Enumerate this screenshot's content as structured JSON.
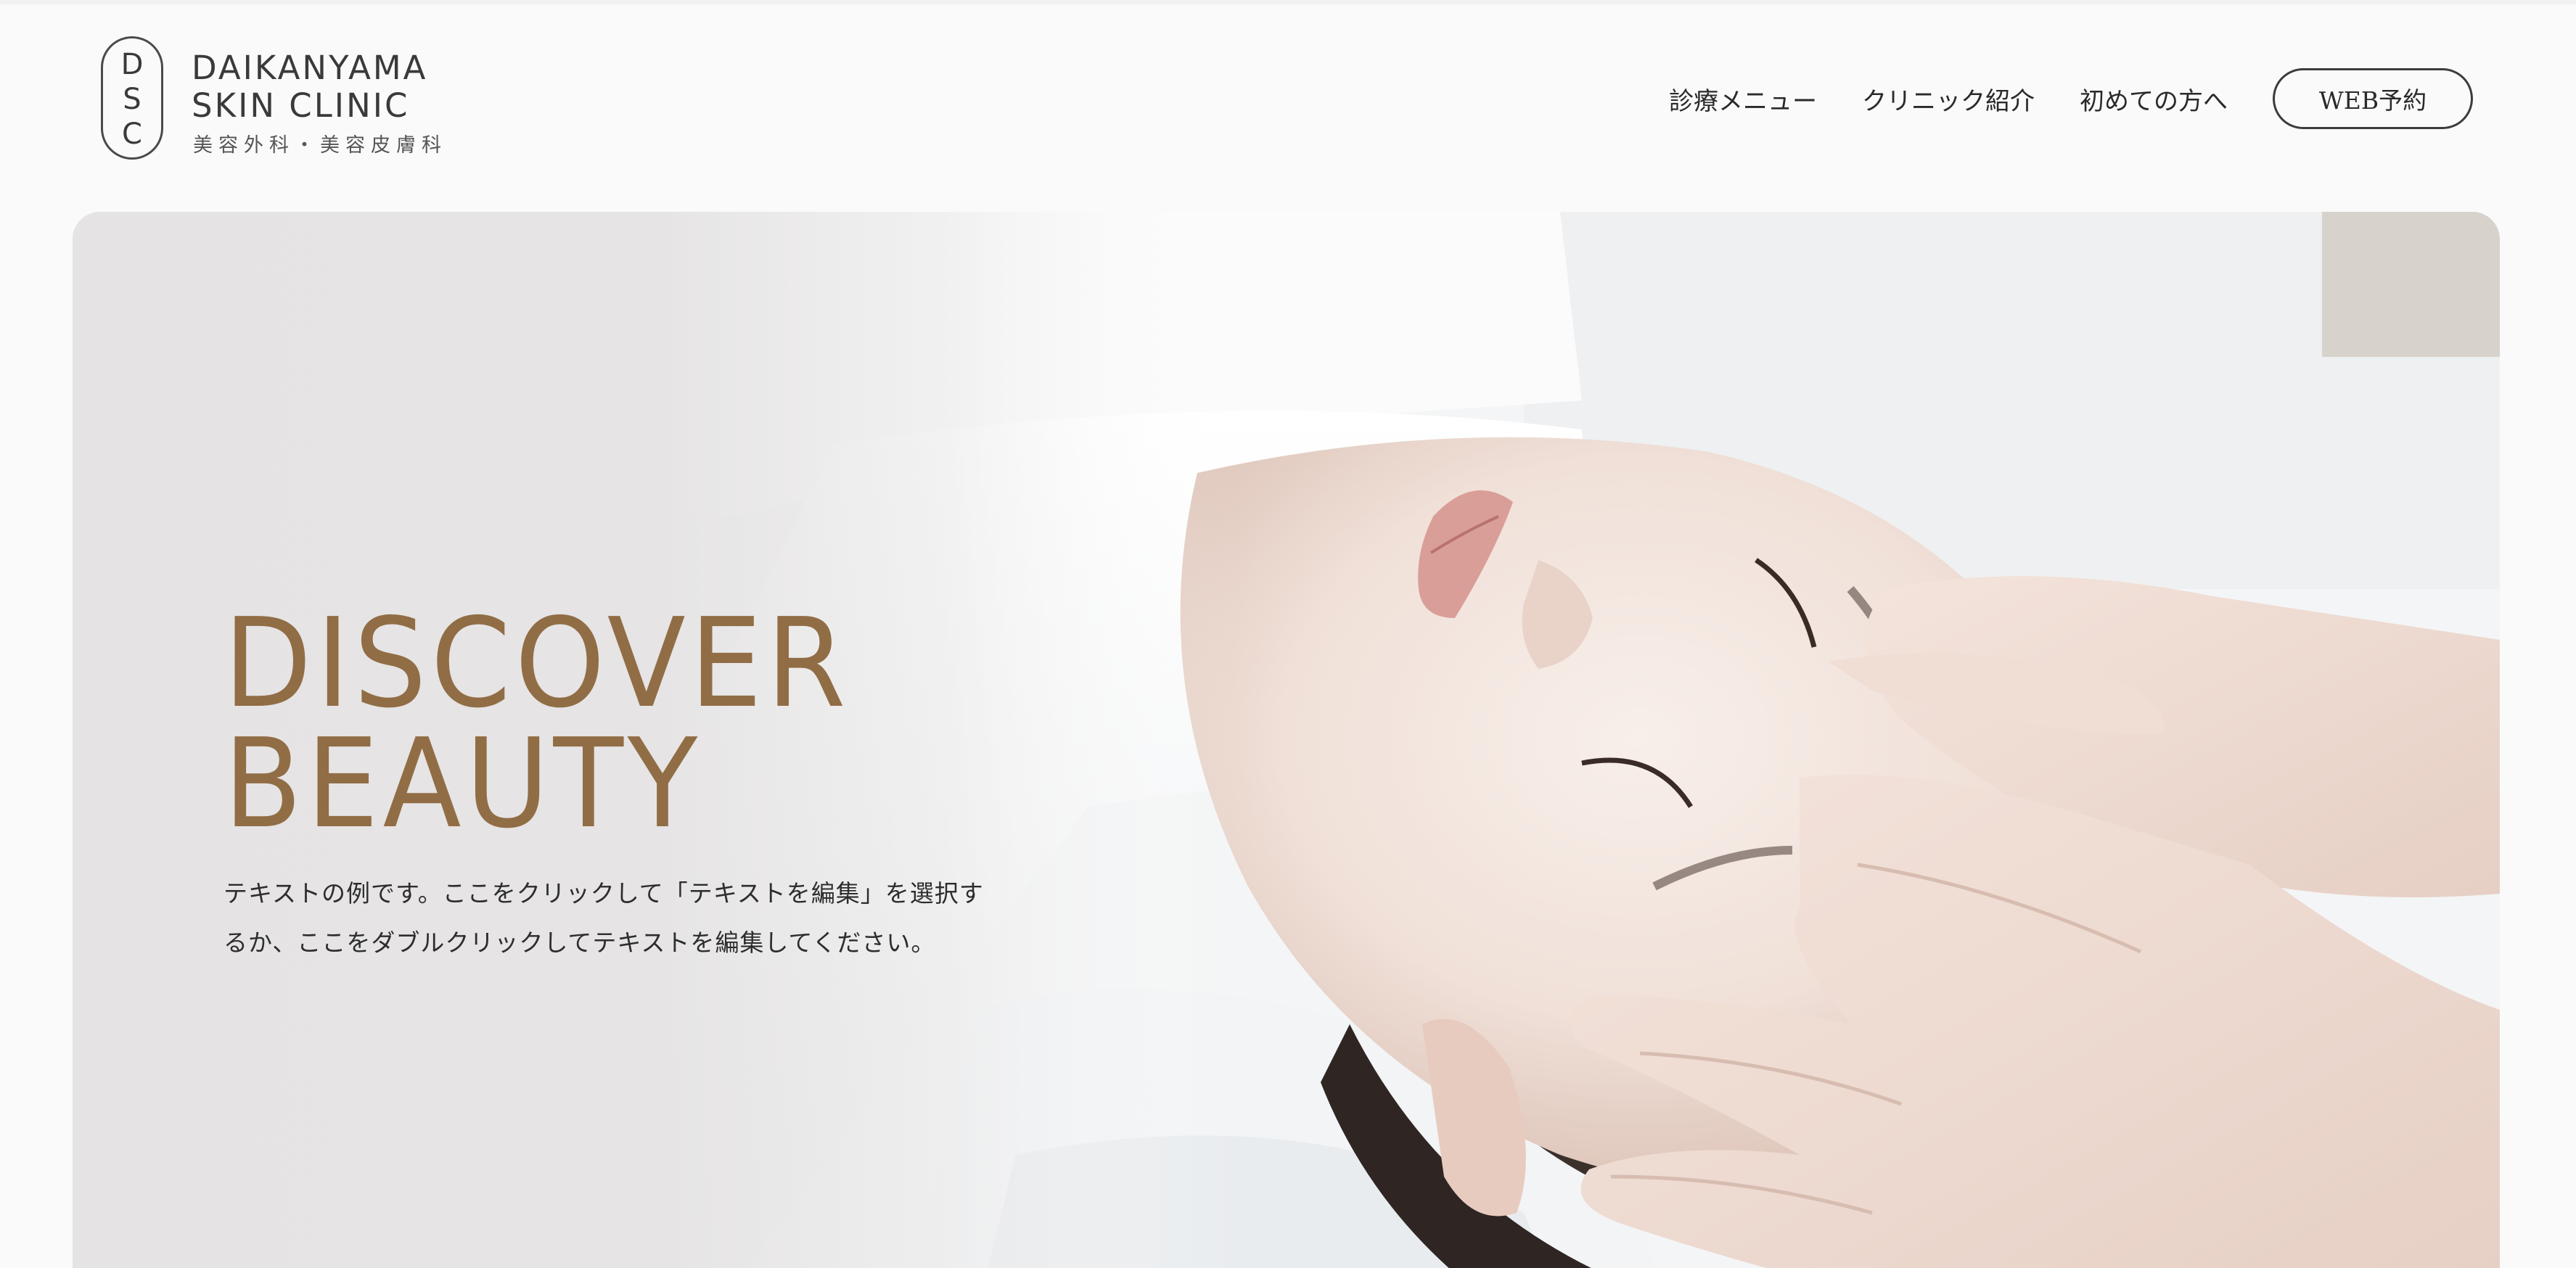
{
  "header": {
    "logo": {
      "mark_letters": [
        "D",
        "S",
        "C"
      ],
      "name_line1": "DAIKANYAMA",
      "name_line2": "SKIN CLINIC",
      "subtitle": "美容外科・美容皮膚科"
    },
    "nav": [
      {
        "label": "診療メニュー"
      },
      {
        "label": "クリニック紹介"
      },
      {
        "label": "初めての方へ"
      }
    ],
    "reserve_button": "WEB予約"
  },
  "hero": {
    "title_line1": "DISCOVER",
    "title_line2": "BEAUTY",
    "desc_line1": "テキストの例です。ここをクリックして「テキストを編集」を選択す",
    "desc_line2": "るか、ここをダブルクリックしてテキストを編集してください。",
    "image": "facial-massage-photo"
  },
  "colors": {
    "accent": "#916d45",
    "background": "#fafafa",
    "hero_panel": "#e5e3e4",
    "text": "#2a2a2a"
  }
}
